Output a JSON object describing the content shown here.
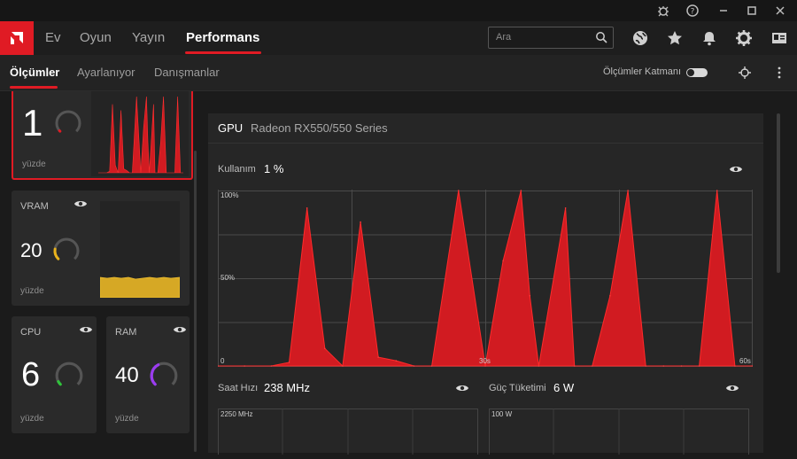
{
  "nav": {
    "tabs": [
      {
        "label": "Ev"
      },
      {
        "label": "Oyun"
      },
      {
        "label": "Yayın"
      },
      {
        "label": "Performans"
      }
    ],
    "search_placeholder": "Ara"
  },
  "subnav": {
    "tabs": [
      {
        "label": "Ölçümler"
      },
      {
        "label": "Ayarlanıyor"
      },
      {
        "label": "Danışmanlar"
      }
    ],
    "overlay_label": "Ölçümler Katmanı"
  },
  "tiles": {
    "gpu": {
      "value": "1",
      "unit": "yüzde",
      "gauge_fraction": 0.01,
      "color": "#e01b24"
    },
    "vram": {
      "label": "VRAM",
      "value": "20",
      "unit": "yüzde",
      "gauge_fraction": 0.2,
      "color": "#e8b21c"
    },
    "cpu": {
      "label": "CPU",
      "value": "6",
      "unit": "yüzde",
      "gauge_fraction": 0.06,
      "color": "#2fc33b"
    },
    "ram": {
      "label": "RAM",
      "value": "40",
      "unit": "yüzde",
      "gauge_fraction": 0.4,
      "color": "#9b3cf0"
    }
  },
  "gpu_panel": {
    "title": "GPU",
    "device": "Radeon RX550/550 Series",
    "usage_label": "Kullanım",
    "usage_value": "1 %",
    "y_labels": {
      "top": "100%",
      "mid": "50%",
      "bottom": "0"
    },
    "x_labels": {
      "mid": "30s",
      "end": "60s"
    },
    "clock_label": "Saat Hızı",
    "clock_value": "238 MHz",
    "clock_max": "2250 MHz",
    "power_label": "Güç Tüketimi",
    "power_value": "6 W",
    "power_max": "100 W"
  },
  "chart_data": {
    "type": "area",
    "title": "",
    "xlabel": "",
    "ylabel": "",
    "ylim": [
      0,
      100
    ],
    "xlim": [
      0,
      60
    ],
    "x": [
      0,
      3,
      6,
      8,
      10,
      12,
      14,
      16,
      18,
      20,
      22,
      24,
      27,
      30,
      32,
      34,
      35,
      36,
      39,
      40,
      42,
      44,
      46,
      48,
      50,
      52,
      54,
      56,
      58,
      60
    ],
    "series": [
      {
        "values": [
          0,
          0,
          0,
          2,
          90,
          10,
          0,
          82,
          5,
          3,
          0,
          0,
          100,
          0,
          60,
          100,
          40,
          0,
          90,
          0,
          0,
          40,
          100,
          0,
          0,
          0,
          0,
          100,
          0,
          0
        ]
      }
    ],
    "color": "#d11b21"
  }
}
